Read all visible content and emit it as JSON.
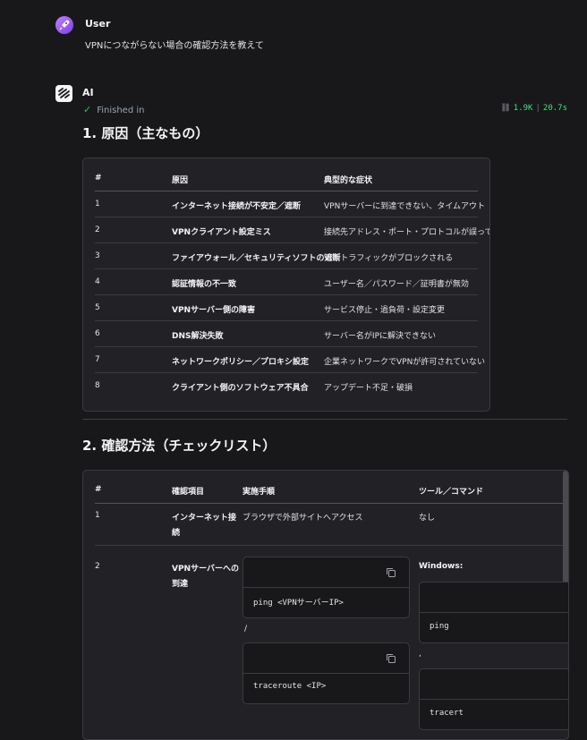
{
  "user": {
    "name": "User",
    "message": "VPNにつながらない場合の確認方法を教えて"
  },
  "ai": {
    "name": "AI",
    "status": "Finished in",
    "stats": {
      "tokens": "1.9K",
      "time": "20.7s"
    }
  },
  "section1": {
    "heading": "1. 原因（主なもの）",
    "headers": [
      "#",
      "原因",
      "典型的な症状"
    ],
    "rows": [
      [
        "1",
        "インターネット接続が不安定／遮断",
        "VPNサーバーに到達できない、タイムアウト"
      ],
      [
        "2",
        "VPNクライアント設定ミス",
        "接続先アドレス・ポート・プロトコルが誤っている"
      ],
      [
        "3",
        "ファイアウォール／セキュリティソフトの遮断",
        "VPNトラフィックがブロックされる"
      ],
      [
        "4",
        "認証情報の不一致",
        "ユーザー名／パスワード／証明書が無効"
      ],
      [
        "5",
        "VPNサーバー側の障害",
        "サービス停止・過負荷・設定変更"
      ],
      [
        "6",
        "DNS解決失敗",
        "サーバー名がIPに解決できない"
      ],
      [
        "7",
        "ネットワークポリシー／プロキシ設定",
        "企業ネットワークでVPNが許可されていない"
      ],
      [
        "8",
        "クライアント側のソフトウェア不具合",
        "アップデート不足・破損"
      ]
    ]
  },
  "section2": {
    "heading": "2. 確認方法（チェックリスト）",
    "headers": [
      "#",
      "確認項目",
      "実施手順",
      "ツール／コマンド"
    ],
    "row1": {
      "num": "1",
      "item_l1": "インターネット接",
      "item_l2": "続",
      "step": "ブラウザで外部サイトへアクセス",
      "tool": "なし"
    },
    "row2": {
      "num": "2",
      "item_l1": "VPNサーバーへの",
      "item_l2": "到達",
      "code1": "ping <VPNサーバーIP>",
      "sep": "/",
      "code2": "traceroute <IP>",
      "tool_label": "Windows:",
      "code3": "ping",
      "sep2": ",",
      "code4": "tracert"
    }
  }
}
